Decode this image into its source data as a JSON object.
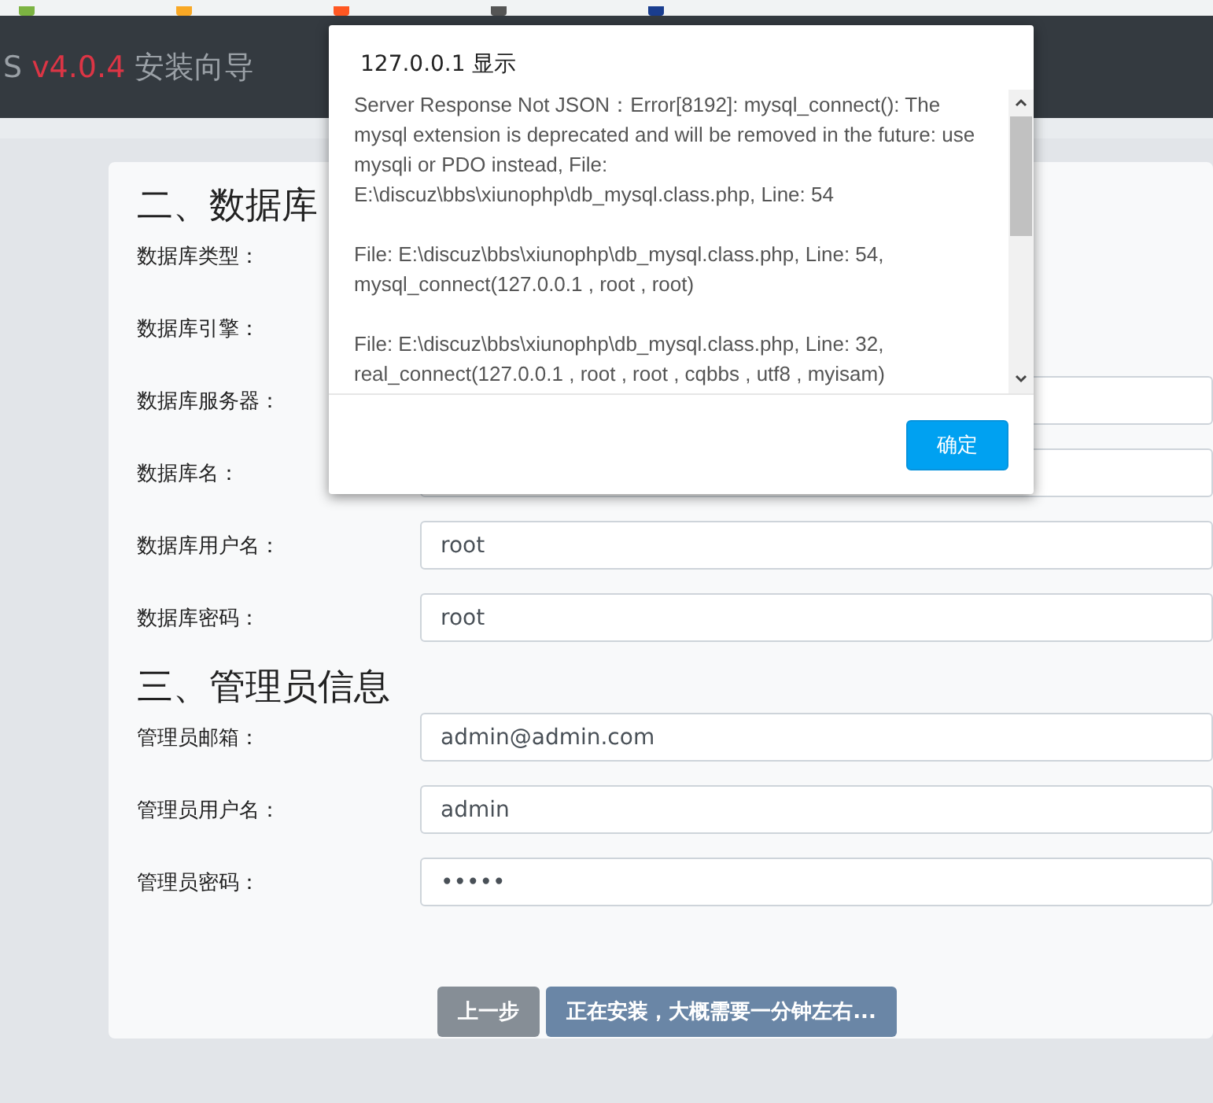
{
  "header": {
    "brand": "S",
    "version": "v4.0.4",
    "title": "安装向导"
  },
  "form": {
    "db_section": {
      "heading": "二、数据库",
      "rows": [
        {
          "label": "数据库类型：",
          "kind": "hidden"
        },
        {
          "label": "数据库引擎：",
          "kind": "hidden"
        },
        {
          "label": "数据库服务器：",
          "kind": "input"
        },
        {
          "label": "数据库名：",
          "kind": "input"
        },
        {
          "label": "数据库用户名：",
          "kind": "input",
          "value": "root"
        },
        {
          "label": "数据库密码：",
          "kind": "input",
          "value": "root"
        }
      ]
    },
    "admin_section": {
      "heading": "三、管理员信息",
      "rows": [
        {
          "label": "管理员邮箱：",
          "kind": "input",
          "value": "admin@admin.com"
        },
        {
          "label": "管理员用户名：",
          "kind": "input",
          "value": "admin"
        },
        {
          "label": "管理员密码：",
          "kind": "input",
          "value": "•••••"
        }
      ]
    },
    "buttons": [
      {
        "label": "上一步",
        "kind": "secondary"
      },
      {
        "label": "正在安装，大概需要一分钟左右...",
        "kind": "primary"
      }
    ]
  },
  "dialog": {
    "title": "127.0.0.1 显示",
    "paragraphs": [
      "Server Response Not JSON：Error[8192]: mysql_connect(): The mysql extension is deprecated and will be removed in the future: use mysqli or PDO instead, File: E:\\discuz\\bbs\\xiunophp\\db_mysql.class.php, Line: 54",
      "File: E:\\discuz\\bbs\\xiunophp\\db_mysql.class.php, Line: 54, mysql_connect(127.0.0.1 , root , root)",
      "File: E:\\discuz\\bbs\\xiunophp\\db_mysql.class.php, Line: 32, real_connect(127.0.0.1 , root , root , cqbbs , utf8 , myisam)"
    ],
    "ok_button": "确定"
  }
}
